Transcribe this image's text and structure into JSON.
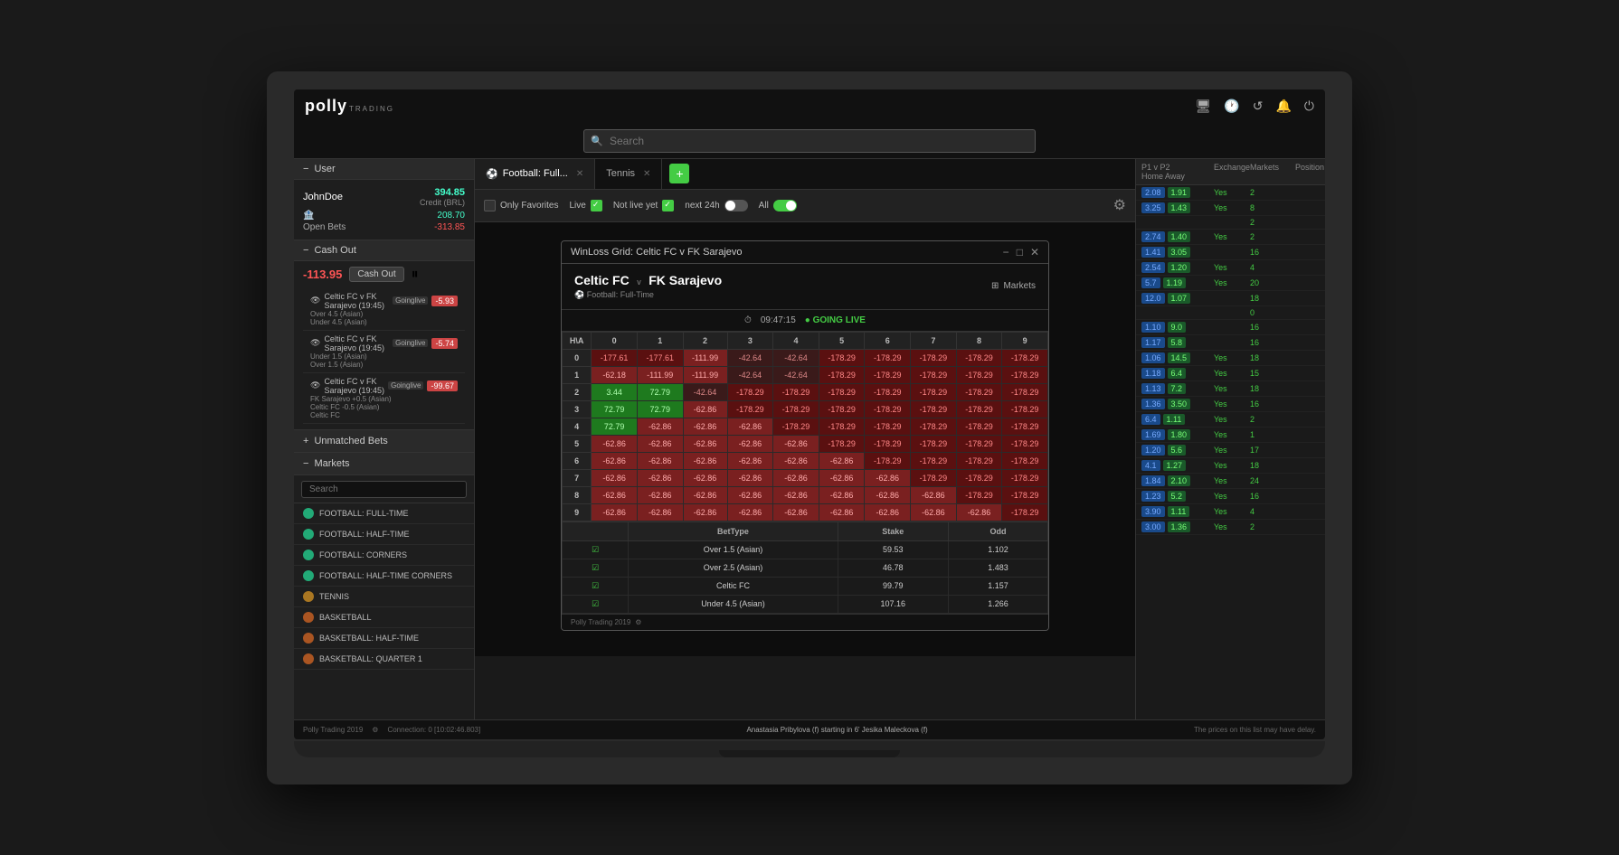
{
  "app": {
    "title": "Polly Trading",
    "logo_main": "polly",
    "logo_sub": "TRADING"
  },
  "topbar": {
    "icons": [
      "monitor-icon",
      "clock-icon",
      "history-icon",
      "bell-icon",
      "power-icon"
    ]
  },
  "user": {
    "section_label": "User",
    "name": "JohnDoe",
    "credit_label": "Credit (BRL)",
    "credit_amount": "394.85",
    "balance_label": "Balance",
    "balance_amount": "208.70",
    "open_bets_label": "Open Bets",
    "open_bets_amount": "-313.85"
  },
  "cashout": {
    "section_label": "Cash Out",
    "amount": "-113.95",
    "button_label": "Cash Out"
  },
  "bets": [
    {
      "match": "Celtic FC v FK Sarajevo (19:45)",
      "tag": "Goinglive",
      "lines": [
        "Over 4.5 (Asian)",
        "Under 4.5 (Asian)"
      ],
      "value": "-5.93"
    },
    {
      "match": "Celtic FC v FK Sarajevo (19:45)",
      "tag": "Goinglive",
      "lines": [
        "Under 1.5 (Asian)",
        "Over 1.5 (Asian)"
      ],
      "value": "-5.74"
    },
    {
      "match": "Celtic FC v FK Sarajevo (19:45)",
      "tag": "Goinglive",
      "lines": [
        "FK Sarajevo +0.5 (Asian)",
        "Celtic FC -0.5 (Asian)",
        "Celtic FC"
      ],
      "value": "-99.67"
    }
  ],
  "unmatched": {
    "section_label": "Unmatched Bets"
  },
  "markets": {
    "section_label": "Markets",
    "search_placeholder": "Search",
    "items": [
      "FOOTBALL: FULL-TIME",
      "FOOTBALL: HALF-TIME",
      "FOOTBALL: CORNERS",
      "FOOTBALL: HALF-TIME CORNERS",
      "TENNIS",
      "BASKETBALL",
      "BASKETBALL: HALF-TIME",
      "BASKETBALL: QUARTER 1"
    ]
  },
  "tabs": [
    {
      "label": "Football: Full...",
      "active": true,
      "closable": true
    },
    {
      "label": "Tennis",
      "active": false,
      "closable": true
    }
  ],
  "filters": {
    "only_favorites": "Only Favorites",
    "live": "Live",
    "not_live_yet": "Not live yet",
    "next_24h": "next 24h",
    "all": "All"
  },
  "search": {
    "placeholder": "Search"
  },
  "modal": {
    "title": "WinLoss Grid: Celtic FC v FK Sarajevo",
    "match_home": "Celtic FC",
    "match_away": "FK Sarajevo",
    "sport": "Football: Full-Time",
    "timer": "09:47:15",
    "going_live": "● GOING LIVE",
    "markets_btn": "Markets",
    "grid_headers": [
      "H\\A",
      "0",
      "1",
      "2",
      "3",
      "4",
      "5",
      "6",
      "7",
      "8",
      "9"
    ],
    "grid_rows": [
      {
        "label": "0",
        "cells": [
          "-177.61",
          "-177.61",
          "-111.99",
          "-42.64",
          "-42.64",
          "-178.29",
          "-178.29",
          "-178.29",
          "-178.29",
          "-178.29"
        ]
      },
      {
        "label": "1",
        "cells": [
          "-62.18",
          "-111.99",
          "-111.99",
          "-42.64",
          "-42.64",
          "-178.29",
          "-178.29",
          "-178.29",
          "-178.29",
          "-178.29"
        ]
      },
      {
        "label": "2",
        "cells": [
          "3.44",
          "72.79",
          "-42.64",
          "-178.29",
          "-178.29",
          "-178.29",
          "-178.29",
          "-178.29",
          "-178.29",
          "-178.29"
        ]
      },
      {
        "label": "3",
        "cells": [
          "72.79",
          "72.79",
          "-62.86",
          "-178.29",
          "-178.29",
          "-178.29",
          "-178.29",
          "-178.29",
          "-178.29",
          "-178.29"
        ]
      },
      {
        "label": "4",
        "cells": [
          "72.79",
          "-62.86",
          "-62.86",
          "-62.86",
          "-178.29",
          "-178.29",
          "-178.29",
          "-178.29",
          "-178.29",
          "-178.29"
        ]
      },
      {
        "label": "5",
        "cells": [
          "-62.86",
          "-62.86",
          "-62.86",
          "-62.86",
          "-62.86",
          "-178.29",
          "-178.29",
          "-178.29",
          "-178.29",
          "-178.29"
        ]
      },
      {
        "label": "6",
        "cells": [
          "-62.86",
          "-62.86",
          "-62.86",
          "-62.86",
          "-62.86",
          "-62.86",
          "-178.29",
          "-178.29",
          "-178.29",
          "-178.29"
        ]
      },
      {
        "label": "7",
        "cells": [
          "-62.86",
          "-62.86",
          "-62.86",
          "-62.86",
          "-62.86",
          "-62.86",
          "-62.86",
          "-178.29",
          "-178.29",
          "-178.29"
        ]
      },
      {
        "label": "8",
        "cells": [
          "-62.86",
          "-62.86",
          "-62.86",
          "-62.86",
          "-62.86",
          "-62.86",
          "-62.86",
          "-62.86",
          "-178.29",
          "-178.29"
        ]
      },
      {
        "label": "9",
        "cells": [
          "-62.86",
          "-62.86",
          "-62.86",
          "-62.86",
          "-62.86",
          "-62.86",
          "-62.86",
          "-62.86",
          "-62.86",
          "-178.29"
        ]
      }
    ],
    "bet_types": [
      {
        "type": "Over 1.5 (Asian)",
        "stake": "59.53",
        "odd": "1.102"
      },
      {
        "type": "Over 2.5 (Asian)",
        "stake": "46.78",
        "odd": "1.483"
      },
      {
        "type": "Celtic FC",
        "stake": "99.79",
        "odd": "1.157"
      },
      {
        "type": "Under 4.5 (Asian)",
        "stake": "107.16",
        "odd": "1.266"
      }
    ],
    "footer": "Polly Trading 2019"
  },
  "odds_panel": {
    "col_home": "P1 v P2\nHome",
    "col_away": "Away",
    "col_exchange": "Exchange",
    "col_markets": "Markets",
    "col_position": "Position",
    "rows": [
      {
        "home": "2.08",
        "away": "1.91",
        "exchange": "Yes",
        "markets": "2",
        "position": ""
      },
      {
        "home": "3.25",
        "away": "1.43",
        "exchange": "Yes",
        "markets": "8",
        "position": ""
      },
      {
        "home": "",
        "away": "",
        "exchange": "",
        "markets": "2",
        "position": ""
      },
      {
        "home": "2.74",
        "away": "1.40",
        "exchange": "Yes",
        "markets": "2",
        "position": ""
      },
      {
        "home": "1.41",
        "away": "3.05",
        "exchange": "",
        "markets": "16",
        "position": ""
      },
      {
        "home": "2.54",
        "away": "1.20",
        "exchange": "Yes",
        "markets": "4",
        "position": ""
      },
      {
        "home": "5.7",
        "away": "1.19",
        "exchange": "Yes",
        "markets": "20",
        "position": ""
      },
      {
        "home": "12.0",
        "away": "1.07",
        "exchange": "",
        "markets": "18",
        "position": ""
      },
      {
        "home": "",
        "away": "",
        "exchange": "",
        "markets": "0",
        "position": ""
      },
      {
        "home": "1.10",
        "away": "9.0",
        "exchange": "",
        "markets": "16",
        "position": ""
      },
      {
        "home": "1.17",
        "away": "5.8",
        "exchange": "",
        "markets": "16",
        "position": ""
      },
      {
        "home": "1.06",
        "away": "14.5",
        "exchange": "Yes",
        "markets": "18",
        "position": ""
      },
      {
        "home": "1.18",
        "away": "6.4",
        "exchange": "Yes",
        "markets": "15",
        "position": ""
      },
      {
        "home": "1.13",
        "away": "7.2",
        "exchange": "Yes",
        "markets": "18",
        "position": ""
      },
      {
        "home": "1.36",
        "away": "3.50",
        "exchange": "Yes",
        "markets": "16",
        "position": ""
      },
      {
        "home": "6.4",
        "away": "1.11",
        "exchange": "Yes",
        "markets": "2",
        "position": ""
      },
      {
        "home": "1.69",
        "away": "1.80",
        "exchange": "Yes",
        "markets": "1",
        "position": ""
      },
      {
        "home": "1.20",
        "away": "5.6",
        "exchange": "Yes",
        "markets": "17",
        "position": ""
      },
      {
        "home": "4.1",
        "away": "1.27",
        "exchange": "Yes",
        "markets": "18",
        "position": ""
      },
      {
        "home": "1.84",
        "away": "2.10",
        "exchange": "Yes",
        "markets": "24",
        "position": ""
      },
      {
        "home": "1.23",
        "away": "5.2",
        "exchange": "Yes",
        "markets": "16",
        "position": ""
      },
      {
        "home": "3.90",
        "away": "1.11",
        "exchange": "Yes",
        "markets": "4",
        "position": ""
      },
      {
        "home": "3.00",
        "away": "1.36",
        "exchange": "Yes",
        "markets": "2",
        "position": ""
      }
    ]
  },
  "status_bar": {
    "left_label": "Polly Trading 2019",
    "connection": "Connection: 0 [10:02:46.803]",
    "center": "Anastasia Pribylova (f)        starting in 6'        Jesika Maleckova (f)",
    "right": "The prices on this list may have delay."
  }
}
